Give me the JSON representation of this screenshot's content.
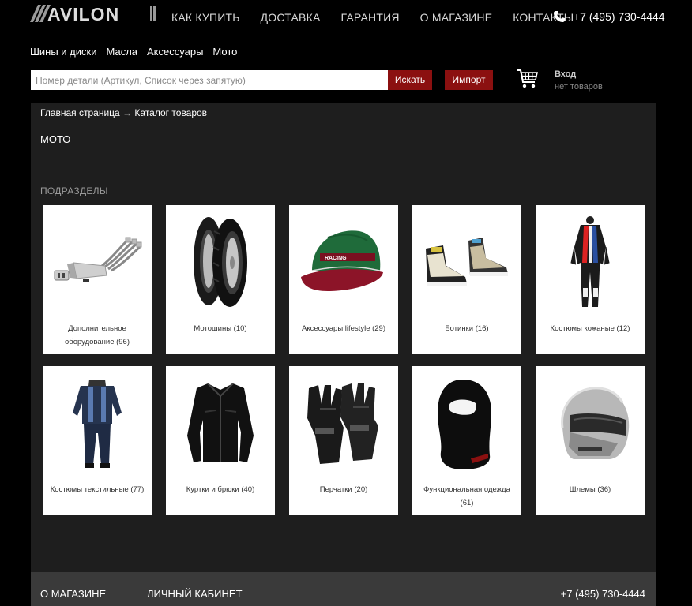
{
  "header": {
    "logo_text": "AVILON",
    "nav": [
      "КАК КУПИТЬ",
      "ДОСТАВКА",
      "ГАРАНТИЯ",
      "О МАГАЗИНЕ",
      "КОНТАКТЫ"
    ],
    "phone": "+7 (495) 730-4444"
  },
  "subnav": [
    "Шины и диски",
    "Масла",
    "Аксессуары",
    "Мото"
  ],
  "search": {
    "placeholder": "Номер детали (Артикул, Список через запятую)",
    "button_label": "Искать",
    "import_label": "Импорт"
  },
  "account": {
    "login_label": "Вход",
    "cart_status": "нет товаров"
  },
  "breadcrumb": {
    "home": "Главная страница",
    "separator": "→",
    "current": "Каталог товаров"
  },
  "page_title": "МОТО",
  "section_title": "ПОДРАЗДЕЛЫ",
  "categories": [
    {
      "label": "Дополнительное оборудование (96)",
      "icon": "exhaust-icon"
    },
    {
      "label": "Мотошины (10)",
      "icon": "tire-icon"
    },
    {
      "label": "Аксессуары lifestyle (29)",
      "icon": "cap-icon"
    },
    {
      "label": "Ботинки (16)",
      "icon": "boots-icon"
    },
    {
      "label": "Костюмы кожаные (12)",
      "icon": "leather-suit-icon"
    },
    {
      "label": "Костюмы текстильные (77)",
      "icon": "textile-suit-icon"
    },
    {
      "label": "Куртки и брюки (40)",
      "icon": "jacket-icon"
    },
    {
      "label": "Перчатки (20)",
      "icon": "gloves-icon"
    },
    {
      "label": "Функциональная одежда (61)",
      "icon": "balaclava-icon"
    },
    {
      "label": "Шлемы (36)",
      "icon": "helmet-icon"
    }
  ],
  "footer": {
    "about": "О МАГАЗИНЕ",
    "cabinet": "ЛИЧНЫЙ КАБИНЕТ",
    "phone": "+7 (495) 730-4444"
  },
  "colors": {
    "accent": "#8b1010",
    "panel": "#1e1e1e",
    "footer": "#3a3a3a"
  }
}
